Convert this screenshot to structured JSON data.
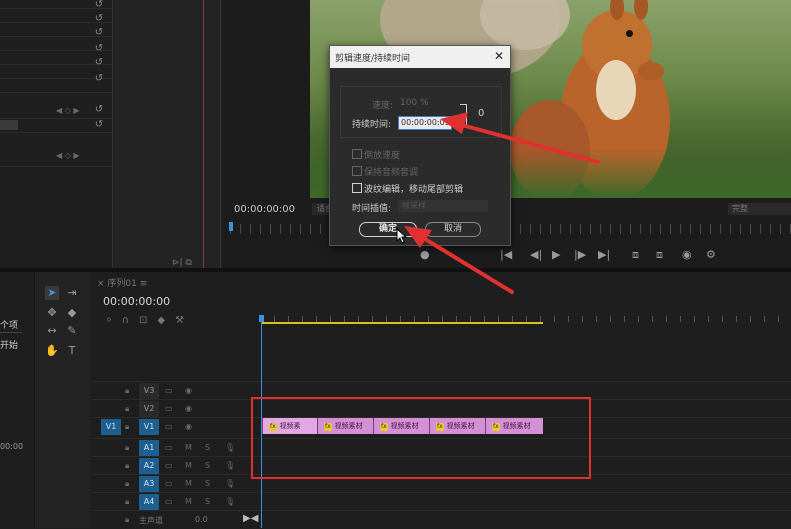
{
  "effects_panel": {
    "rows": 10
  },
  "program_monitor": {
    "timecode": "00:00:00:00",
    "fit_label": "适合",
    "resolution_label": "完整",
    "transport_icons": [
      "step-back-icon",
      "play-icon",
      "step-forward-icon",
      "go-to-out-icon",
      "lift-icon",
      "extract-icon",
      "export-frame-icon",
      "settings-icon"
    ]
  },
  "dialog": {
    "title": "剪辑速度/持续时间",
    "close": "✕",
    "speed_label": "速度:",
    "speed_value": "100 %",
    "duration_label": "持续时间:",
    "duration_value": "00:00:00:05",
    "chk_reverse": "倒放速度",
    "chk_audio_pitch": "保持音频音调",
    "chk_ripple": "波纹编辑，移动尾部剪辑",
    "interp_label": "时间插值:",
    "interp_value": "帧采样",
    "ok": "确定",
    "cancel": "取消"
  },
  "timeline": {
    "tab": "序列01",
    "timecode": "00:00:00:00",
    "project_text_1": "个项",
    "project_text_2": "开始",
    "project_time": "00:00",
    "video_tracks": [
      "V3",
      "V2",
      "V1"
    ],
    "audio_tracks": [
      "A1",
      "A2",
      "A3",
      "A4"
    ],
    "source_v1": "V1",
    "master_label": "主声道",
    "master_value": "0.0",
    "clips": [
      "视频素",
      "视频素材",
      "视频素材",
      "视频素材",
      "视频素材"
    ]
  },
  "colors": {
    "clip": "#d58fd5",
    "highlight": "#e03030",
    "playhead": "#3d8fe0",
    "work_area": "#d6c21c"
  }
}
